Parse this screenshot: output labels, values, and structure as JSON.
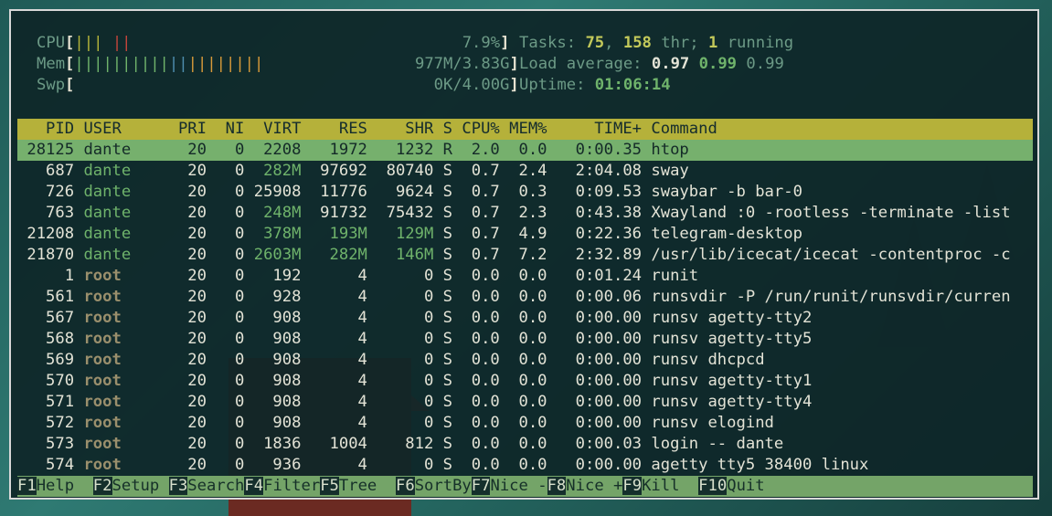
{
  "meters": {
    "cpu": {
      "label": "CPU",
      "value": "7.9%"
    },
    "mem": {
      "label": "Mem",
      "value": "977M/3.83G"
    },
    "swp": {
      "label": "Swp",
      "value": "0K/4.00G"
    }
  },
  "summary": {
    "tasks_label": "Tasks: ",
    "tasks": "75",
    "threads": "158",
    "thr_label": " thr; ",
    "running": "1",
    "running_label": " running",
    "load_label": "Load average: ",
    "load1": "0.97",
    "load5": "0.99",
    "load15": "0.99",
    "uptime_label": "Uptime: ",
    "uptime": "01:06:14"
  },
  "columns": [
    "PID",
    "USER",
    "PRI",
    "NI",
    "VIRT",
    "RES",
    "SHR",
    "S",
    "CPU%",
    "MEM%",
    "TIME+",
    "Command"
  ],
  "processes": [
    {
      "pid": "28125",
      "user": "dante",
      "pri": "20",
      "ni": "0",
      "virt": "2208",
      "res": "1972",
      "shr": "1232",
      "s": "R",
      "cpu": "2.0",
      "mem": "0.0",
      "time": "0:00.35",
      "cmd": "htop"
    },
    {
      "pid": "687",
      "user": "dante",
      "pri": "20",
      "ni": "0",
      "virt": "282M",
      "res": "97692",
      "shr": "80740",
      "s": "S",
      "cpu": "0.7",
      "mem": "2.4",
      "time": "2:04.08",
      "cmd": "sway"
    },
    {
      "pid": "726",
      "user": "dante",
      "pri": "20",
      "ni": "0",
      "virt": "25908",
      "res": "11776",
      "shr": "9624",
      "s": "S",
      "cpu": "0.7",
      "mem": "0.3",
      "time": "0:09.53",
      "cmd": "swaybar -b bar-0"
    },
    {
      "pid": "763",
      "user": "dante",
      "pri": "20",
      "ni": "0",
      "virt": "248M",
      "res": "91732",
      "shr": "75432",
      "s": "S",
      "cpu": "0.7",
      "mem": "2.3",
      "time": "0:43.38",
      "cmd": "Xwayland :0 -rootless -terminate -list"
    },
    {
      "pid": "21208",
      "user": "dante",
      "pri": "20",
      "ni": "0",
      "virt": "378M",
      "res": "193M",
      "shr": "129M",
      "s": "S",
      "cpu": "0.7",
      "mem": "4.9",
      "time": "0:22.36",
      "cmd": "telegram-desktop"
    },
    {
      "pid": "21870",
      "user": "dante",
      "pri": "20",
      "ni": "0",
      "virt": "2603M",
      "res": "282M",
      "shr": "146M",
      "s": "S",
      "cpu": "0.7",
      "mem": "7.2",
      "time": "2:32.89",
      "cmd": "/usr/lib/icecat/icecat -contentproc -c"
    },
    {
      "pid": "1",
      "user": "root",
      "pri": "20",
      "ni": "0",
      "virt": "192",
      "res": "4",
      "shr": "0",
      "s": "S",
      "cpu": "0.0",
      "mem": "0.0",
      "time": "0:01.24",
      "cmd": "runit"
    },
    {
      "pid": "561",
      "user": "root",
      "pri": "20",
      "ni": "0",
      "virt": "928",
      "res": "4",
      "shr": "0",
      "s": "S",
      "cpu": "0.0",
      "mem": "0.0",
      "time": "0:00.06",
      "cmd": "runsvdir -P /run/runit/runsvdir/curren"
    },
    {
      "pid": "567",
      "user": "root",
      "pri": "20",
      "ni": "0",
      "virt": "908",
      "res": "4",
      "shr": "0",
      "s": "S",
      "cpu": "0.0",
      "mem": "0.0",
      "time": "0:00.00",
      "cmd": "runsv agetty-tty2"
    },
    {
      "pid": "568",
      "user": "root",
      "pri": "20",
      "ni": "0",
      "virt": "908",
      "res": "4",
      "shr": "0",
      "s": "S",
      "cpu": "0.0",
      "mem": "0.0",
      "time": "0:00.00",
      "cmd": "runsv agetty-tty5"
    },
    {
      "pid": "569",
      "user": "root",
      "pri": "20",
      "ni": "0",
      "virt": "908",
      "res": "4",
      "shr": "0",
      "s": "S",
      "cpu": "0.0",
      "mem": "0.0",
      "time": "0:00.00",
      "cmd": "runsv dhcpcd"
    },
    {
      "pid": "570",
      "user": "root",
      "pri": "20",
      "ni": "0",
      "virt": "908",
      "res": "4",
      "shr": "0",
      "s": "S",
      "cpu": "0.0",
      "mem": "0.0",
      "time": "0:00.00",
      "cmd": "runsv agetty-tty1"
    },
    {
      "pid": "571",
      "user": "root",
      "pri": "20",
      "ni": "0",
      "virt": "908",
      "res": "4",
      "shr": "0",
      "s": "S",
      "cpu": "0.0",
      "mem": "0.0",
      "time": "0:00.00",
      "cmd": "runsv agetty-tty4"
    },
    {
      "pid": "572",
      "user": "root",
      "pri": "20",
      "ni": "0",
      "virt": "908",
      "res": "4",
      "shr": "0",
      "s": "S",
      "cpu": "0.0",
      "mem": "0.0",
      "time": "0:00.00",
      "cmd": "runsv elogind"
    },
    {
      "pid": "573",
      "user": "root",
      "pri": "20",
      "ni": "0",
      "virt": "1836",
      "res": "1004",
      "shr": "812",
      "s": "S",
      "cpu": "0.0",
      "mem": "0.0",
      "time": "0:00.03",
      "cmd": "login -- dante"
    },
    {
      "pid": "574",
      "user": "root",
      "pri": "20",
      "ni": "0",
      "virt": "936",
      "res": "4",
      "shr": "0",
      "s": "S",
      "cpu": "0.0",
      "mem": "0.0",
      "time": "0:00.00",
      "cmd": "agetty tty5 38400 linux"
    }
  ],
  "fkeys": [
    {
      "key": "F1",
      "label": "Help  "
    },
    {
      "key": "F2",
      "label": "Setup "
    },
    {
      "key": "F3",
      "label": "Search"
    },
    {
      "key": "F4",
      "label": "Filter"
    },
    {
      "key": "F5",
      "label": "Tree  "
    },
    {
      "key": "F6",
      "label": "SortBy"
    },
    {
      "key": "F7",
      "label": "Nice -"
    },
    {
      "key": "F8",
      "label": "Nice +"
    },
    {
      "key": "F9",
      "label": "Kill  "
    },
    {
      "key": "F10",
      "label": "Quit"
    }
  ],
  "colors": {
    "header_bg": "#b5b13a",
    "selection_bg": "#76b06d",
    "terminal_bg": "#0e2628",
    "fkey_bg": "#74a468"
  }
}
